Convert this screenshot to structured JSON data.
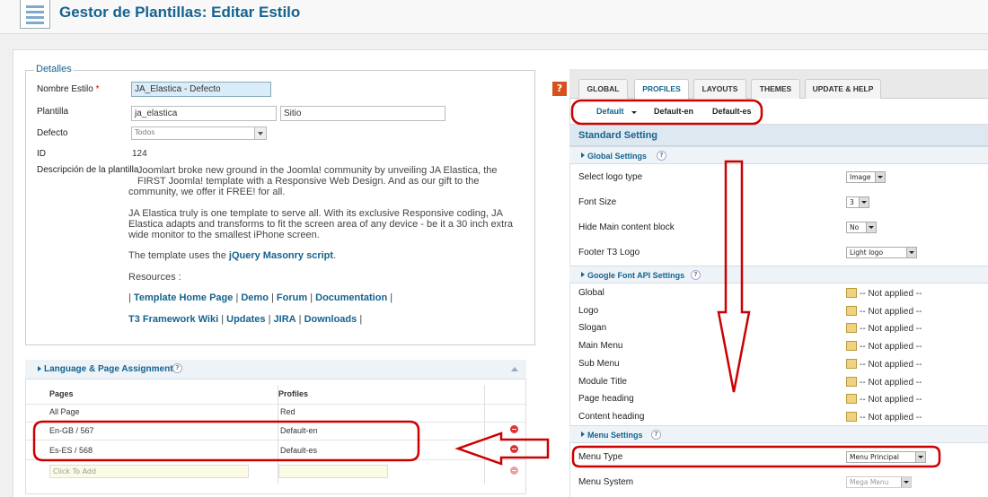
{
  "header": {
    "title": "Gestor de Plantillas: Editar Estilo",
    "icon": "template-manager-icon"
  },
  "details": {
    "legend": "Detalles",
    "style_name_label": "Nombre Estilo",
    "required_mark": "*",
    "style_name_value": "JA_Elastica - Defecto",
    "template_label": "Plantilla",
    "template_value": "ja_elastica",
    "template_client": "Sitio",
    "default_label": "Defecto",
    "default_value": "Todos",
    "id_label": "ID",
    "id_value": "124",
    "description_label": "Descripción de la plantilla",
    "desc_p1_l1": "Joomlart broke new ground in the Joomla! community by unveiling JA Elastica, the",
    "desc_p1_l2": "FIRST Joomla! template with a Responsive Web Design. And as our gift to the",
    "desc_p1_l3": "community, we offer it FREE! for all.",
    "desc_p2_l1": "JA Elastica truly is one template to serve all. With its exclusive Responsive coding, JA",
    "desc_p2_l2": "Elastica adapts and transforms to fit the screen area of any device - be it a 30 inch extra",
    "desc_p2_l3": "wide monitor to the smallest iPhone screen.",
    "desc_p3_prefix": "The template uses the ",
    "desc_p3_link": "jQuery Masonry script",
    "desc_p3_suffix": ".",
    "resources_label": "Resources :",
    "links_row1": [
      "Template Home Page",
      "Demo",
      "Forum",
      "Documentation"
    ],
    "links_row2": [
      "T3 Framework Wiki",
      "Updates",
      "JIRA",
      "Downloads"
    ],
    "sep": "|"
  },
  "lang": {
    "title": "Language & Page Assignments",
    "help": "?",
    "col_pages": "Pages",
    "col_profiles": "Profiles",
    "rows": [
      {
        "page": "All Page",
        "profile": "Red"
      },
      {
        "page": "En-GB / 567",
        "profile": "Default-en"
      },
      {
        "page": "Es-ES / 568",
        "profile": "Default-es"
      }
    ],
    "add_placeholder": "Click To Add"
  },
  "help_icon": "?",
  "tabs": [
    "GLOBAL",
    "PROFILES",
    "LAYOUTS",
    "THEMES",
    "UPDATE & HELP"
  ],
  "profiles": {
    "items": [
      "Default",
      "Default-en",
      "Default-es"
    ]
  },
  "standard": "Standard Setting",
  "global_settings": {
    "title": "Global Settings",
    "logo_type_label": "Select logo type",
    "logo_type_value": "Image",
    "font_size_label": "Font Size",
    "font_size_value": "3",
    "hide_main_label": "Hide Main content block",
    "hide_main_value": "No",
    "footer_logo_label": "Footer T3 Logo",
    "footer_logo_value": "Light logo"
  },
  "google_font": {
    "title": "Google Font API Settings",
    "not_applied": "-- Not applied --",
    "labels": [
      "Global",
      "Logo",
      "Slogan",
      "Main Menu",
      "Sub Menu",
      "Module Title",
      "Page heading",
      "Content heading"
    ]
  },
  "menu_settings": {
    "title": "Menu Settings",
    "menu_type_label": "Menu Type",
    "menu_type_value": "Menu Principal",
    "menu_system_label": "Menu System",
    "menu_system_value": "Mega Menu"
  },
  "colors": {
    "accent": "#14638f",
    "annotation": "#cc0000",
    "highlight": "#d9ecf8"
  }
}
